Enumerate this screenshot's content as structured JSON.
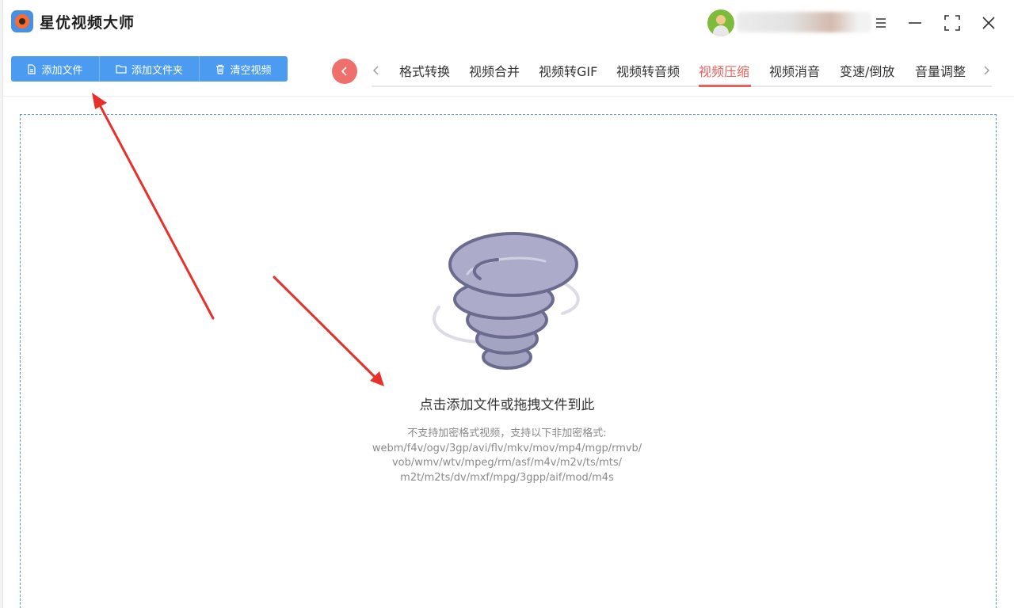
{
  "app": {
    "title": "星优视频大师",
    "icon": "app-logo-icon"
  },
  "window_controls": [
    "menu-icon",
    "minimize-icon",
    "maximize-icon",
    "close-icon"
  ],
  "toolbar": {
    "buttons": [
      {
        "label": "添加文件",
        "icon": "file-icon"
      },
      {
        "label": "添加文件夹",
        "icon": "folder-icon"
      },
      {
        "label": "清空视频",
        "icon": "trash-icon"
      }
    ]
  },
  "tabs": {
    "items": [
      "格式转换",
      "视频合并",
      "视频转GIF",
      "视频转音频",
      "视频压缩",
      "视频消音",
      "变速/倒放",
      "音量调整"
    ],
    "active": "视频压缩"
  },
  "dropzone": {
    "title": "点击添加文件或拖拽文件到此",
    "support_lines": [
      "不支持加密格式视频，支持以下非加密格式:",
      "webm/f4v/ogv/3gp/avi/flv/mkv/mov/mp4/mgp/rmvb/",
      "vob/wmv/wtv/mpeg/rm/asf/m4v/m2v/ts/mts/",
      "m2t/m2ts/dv/mxf/mpg/3gpp/aif/mod/m4s"
    ]
  },
  "colors": {
    "primary_blue": "#4b9cf1",
    "active_tab": "#e8615e",
    "nav_circle": "#ef6f6c",
    "annotation_arrow": "#e8302a"
  }
}
